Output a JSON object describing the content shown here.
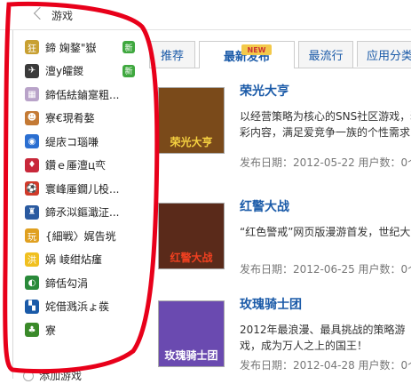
{
  "topbar": {
    "title": "游戏"
  },
  "sidebar": {
    "items": [
      {
        "label": "鍗    婅鍪\"嶽",
        "icon_text": "狂",
        "icon_color": "#c8a032",
        "is_new": true
      },
      {
        "label": "澶у皬鍐",
        "icon_text": "✈",
        "icon_color": "#3a3a3a",
        "is_new": true
      },
      {
        "label": "鍗佸紶鏀寔粗...",
        "icon_text": "▦",
        "icon_color": "#b9a3c9",
        "is_new": false
      },
      {
        "label": "寮€現肴嫯",
        "icon_text": "☻",
        "icon_color": "#c47a35",
        "is_new": false
      },
      {
        "label": "缇庡コ瑙嗛",
        "icon_text": "◉",
        "icon_color": "#2b6fd1",
        "is_new": false
      },
      {
        "label": "鑽ｅ厜澶ц亪",
        "icon_text": "♦",
        "icon_color": "#c8283a",
        "is_new": false
      },
      {
        "label": "寰峰厜鐗儿杸...",
        "icon_text": "⚽",
        "icon_color": "#d03a2a",
        "is_new": false
      },
      {
        "label": "鍗氶泤鏂濈泟...",
        "icon_text": "♜",
        "icon_color": "#2a5aa0",
        "is_new": false
      },
      {
        "label": "{細戦〉娓告垙",
        "icon_text": "玩",
        "icon_color": "#e0a020",
        "is_new": false
      },
      {
        "label": "娲  崚绀炶瘽",
        "icon_text": "洪",
        "icon_color": "#f0c020",
        "is_new": false
      },
      {
        "label": "鍗佸勾涓",
        "icon_text": "◐",
        "icon_color": "#2a8a3a",
        "is_new": false
      },
      {
        "label": "姹借溅浜ょ彂",
        "icon_text": "▚",
        "icon_color": "#1a5aa8",
        "is_new": false
      },
      {
        "label": "寮",
        "icon_text": "♣",
        "icon_color": "#3a8a2a",
        "is_new": false
      }
    ]
  },
  "bottom_item": {
    "label": "添加游戏"
  },
  "tabs": [
    {
      "label": "推荐",
      "active": false
    },
    {
      "label": "最新发布",
      "active": true
    },
    {
      "label": "最流行",
      "active": false
    },
    {
      "label": "应用分类",
      "active": false
    }
  ],
  "hot_flag": "NEW",
  "games": [
    {
      "name": "荣光大亨",
      "thumb_text": "荣光大亨",
      "desc": "以经营策略为核心的SNS社区游戏，精彩内容，满足爱竞争一族的个性需求",
      "meta": "发布日期：2012-05-22 用户数：0个",
      "thumb_bg": "#7a4a1a",
      "thumb_fg": "#f5d040"
    },
    {
      "name": "红警大战",
      "thumb_text": "红警大战",
      "desc": "“红色警戒”网页版漫游首发，世纪大战",
      "meta": "发布日期：2012-06-25 用户数：0个",
      "thumb_bg": "#5a2a1a",
      "thumb_fg": "#f04020"
    },
    {
      "name": "玫瑰骑士团",
      "thumb_text": "玫瑰骑士团",
      "desc": "2012年最浪漫、最具挑战的策略游戏，成为万人之上的国王！",
      "meta": "发布日期：2012-04-28 用户数：0个",
      "thumb_bg": "#6a4ab0",
      "thumb_fg": "#ffffff"
    }
  ],
  "colors": {
    "accent": "#1a5aa8",
    "annotation": "#e8001a"
  }
}
